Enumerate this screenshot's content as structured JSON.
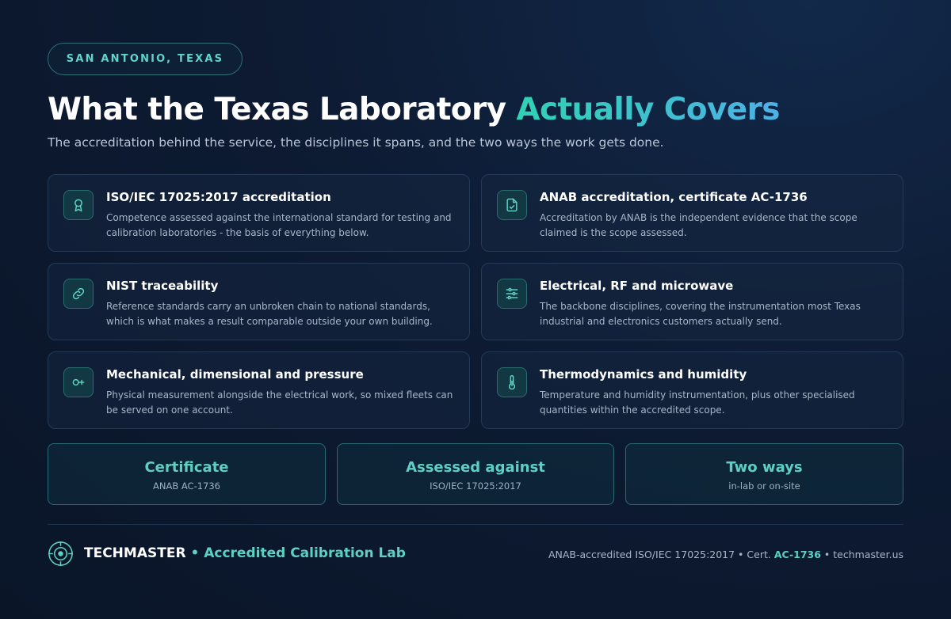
{
  "badge": "SAN ANTONIO, TEXAS",
  "title": {
    "main": "What the Texas Laboratory ",
    "accent": "Actually Covers"
  },
  "subtitle": "The accreditation behind the service, the disciplines it spans, and the two ways the work gets done.",
  "cards": [
    {
      "icon": "award-ribbon-icon",
      "title": "ISO/IEC 17025:2017 accreditation",
      "desc": "Competence assessed against the international standard for testing and calibration laboratories - the basis of everything below."
    },
    {
      "icon": "certificate-document-icon",
      "title": "ANAB accreditation, certificate AC-1736",
      "desc": "Accreditation by ANAB is the independent evidence that the scope claimed is the scope assessed."
    },
    {
      "icon": "chain-link-icon",
      "title": "NIST traceability",
      "desc": "Reference standards carry an unbroken chain to national standards, which is what makes a result comparable outside your own building."
    },
    {
      "icon": "sliders-icon",
      "title": "Electrical, RF and microwave",
      "desc": "The backbone disciplines, covering the instrumentation most Texas industrial and electronics customers actually send."
    },
    {
      "icon": "gauge-probe-icon",
      "title": "Mechanical, dimensional and pressure",
      "desc": "Physical measurement alongside the electrical work, so mixed fleets can be served on one account."
    },
    {
      "icon": "thermometer-icon",
      "title": "Thermodynamics and humidity",
      "desc": "Temperature and humidity instrumentation, plus other specialised quantities within the accredited scope."
    }
  ],
  "stats": [
    {
      "value": "Certificate",
      "label": "ANAB AC-1736"
    },
    {
      "value": "Assessed against",
      "label": "ISO/IEC 17025:2017"
    },
    {
      "value": "Two ways",
      "label": "in-lab or on-site"
    }
  ],
  "footer": {
    "brand_name": "TECHMASTER",
    "brand_sep": " • ",
    "brand_sub": "Accredited Calibration Lab",
    "note_pre": "ANAB-accredited ISO/IEC 17025:2017 • Cert. ",
    "note_cert": "AC-1736",
    "note_post": " • techmaster.us"
  },
  "colors": {
    "accent": "#5ed0c3",
    "accent_gradient_end": "#4fb0e6",
    "background": "#0d1b33"
  }
}
